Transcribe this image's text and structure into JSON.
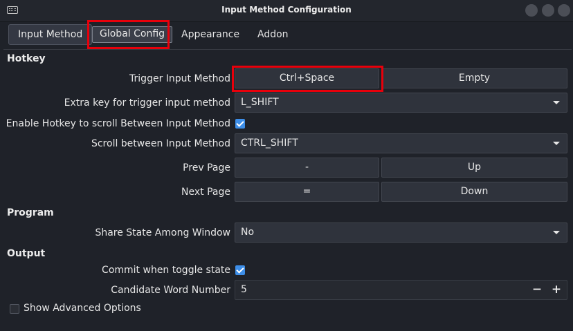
{
  "window": {
    "title": "Input Method Configuration"
  },
  "tabs": [
    {
      "label": "Input Method"
    },
    {
      "label": "Global Config"
    },
    {
      "label": "Appearance"
    },
    {
      "label": "Addon"
    }
  ],
  "hotkey": {
    "section_title": "Hotkey",
    "trigger_label": "Trigger Input Method",
    "trigger_key1": "Ctrl+Space",
    "trigger_key2": "Empty",
    "extra_key_label": "Extra key for trigger input method",
    "extra_key_value": "L_SHIFT",
    "enable_scroll_label": "Enable Hotkey to scroll Between Input Method",
    "enable_scroll_checked": true,
    "scroll_label": "Scroll between Input Method",
    "scroll_value": "CTRL_SHIFT",
    "prev_page_label": "Prev Page",
    "prev_page_key1": "-",
    "prev_page_key2": "Up",
    "next_page_label": "Next Page",
    "next_page_key1": "=",
    "next_page_key2": "Down"
  },
  "program": {
    "section_title": "Program",
    "share_state_label": "Share State Among Window",
    "share_state_value": "No"
  },
  "output": {
    "section_title": "Output",
    "commit_toggle_label": "Commit when toggle state",
    "commit_toggle_checked": true,
    "candidate_label": "Candidate Word Number",
    "candidate_value": "5",
    "minus": "−",
    "plus": "+"
  },
  "advanced": {
    "label": "Show Advanced Options",
    "checked": false
  },
  "colors": {
    "background": "#1f2229",
    "accent": "#3d8ee8",
    "highlight": "#e8000b"
  }
}
